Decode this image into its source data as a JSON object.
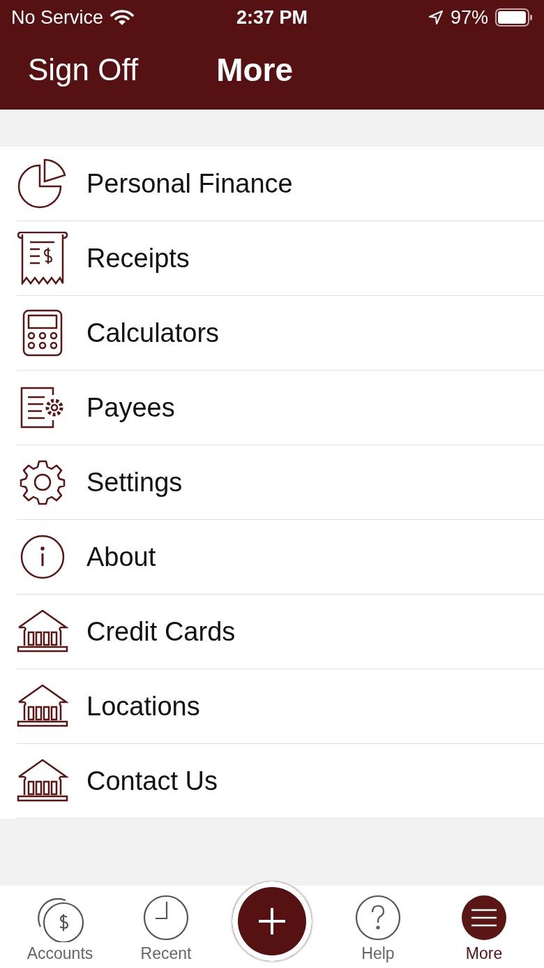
{
  "status_bar": {
    "carrier": "No Service",
    "time": "2:37 PM",
    "battery": "97%"
  },
  "nav_bar": {
    "left_button": "Sign Off",
    "title": "More"
  },
  "menu": [
    {
      "label": "Personal Finance",
      "kind": "pie"
    },
    {
      "label": "Receipts",
      "kind": "receipt"
    },
    {
      "label": "Calculators",
      "kind": "calculator"
    },
    {
      "label": "Payees",
      "kind": "document-gear"
    },
    {
      "label": "Settings",
      "kind": "gear"
    },
    {
      "label": "About",
      "kind": "info"
    },
    {
      "label": "Credit Cards",
      "kind": "bank"
    },
    {
      "label": "Locations",
      "kind": "bank"
    },
    {
      "label": "Contact Us",
      "kind": "bank"
    }
  ],
  "tab_bar": [
    {
      "label": "Accounts",
      "kind": "coins",
      "selected": false
    },
    {
      "label": "Recent",
      "kind": "clock",
      "selected": false
    },
    {
      "kind": "add",
      "selected": false
    },
    {
      "label": "Help",
      "kind": "help",
      "selected": false
    },
    {
      "label": "More",
      "kind": "menu",
      "selected": true
    }
  ]
}
